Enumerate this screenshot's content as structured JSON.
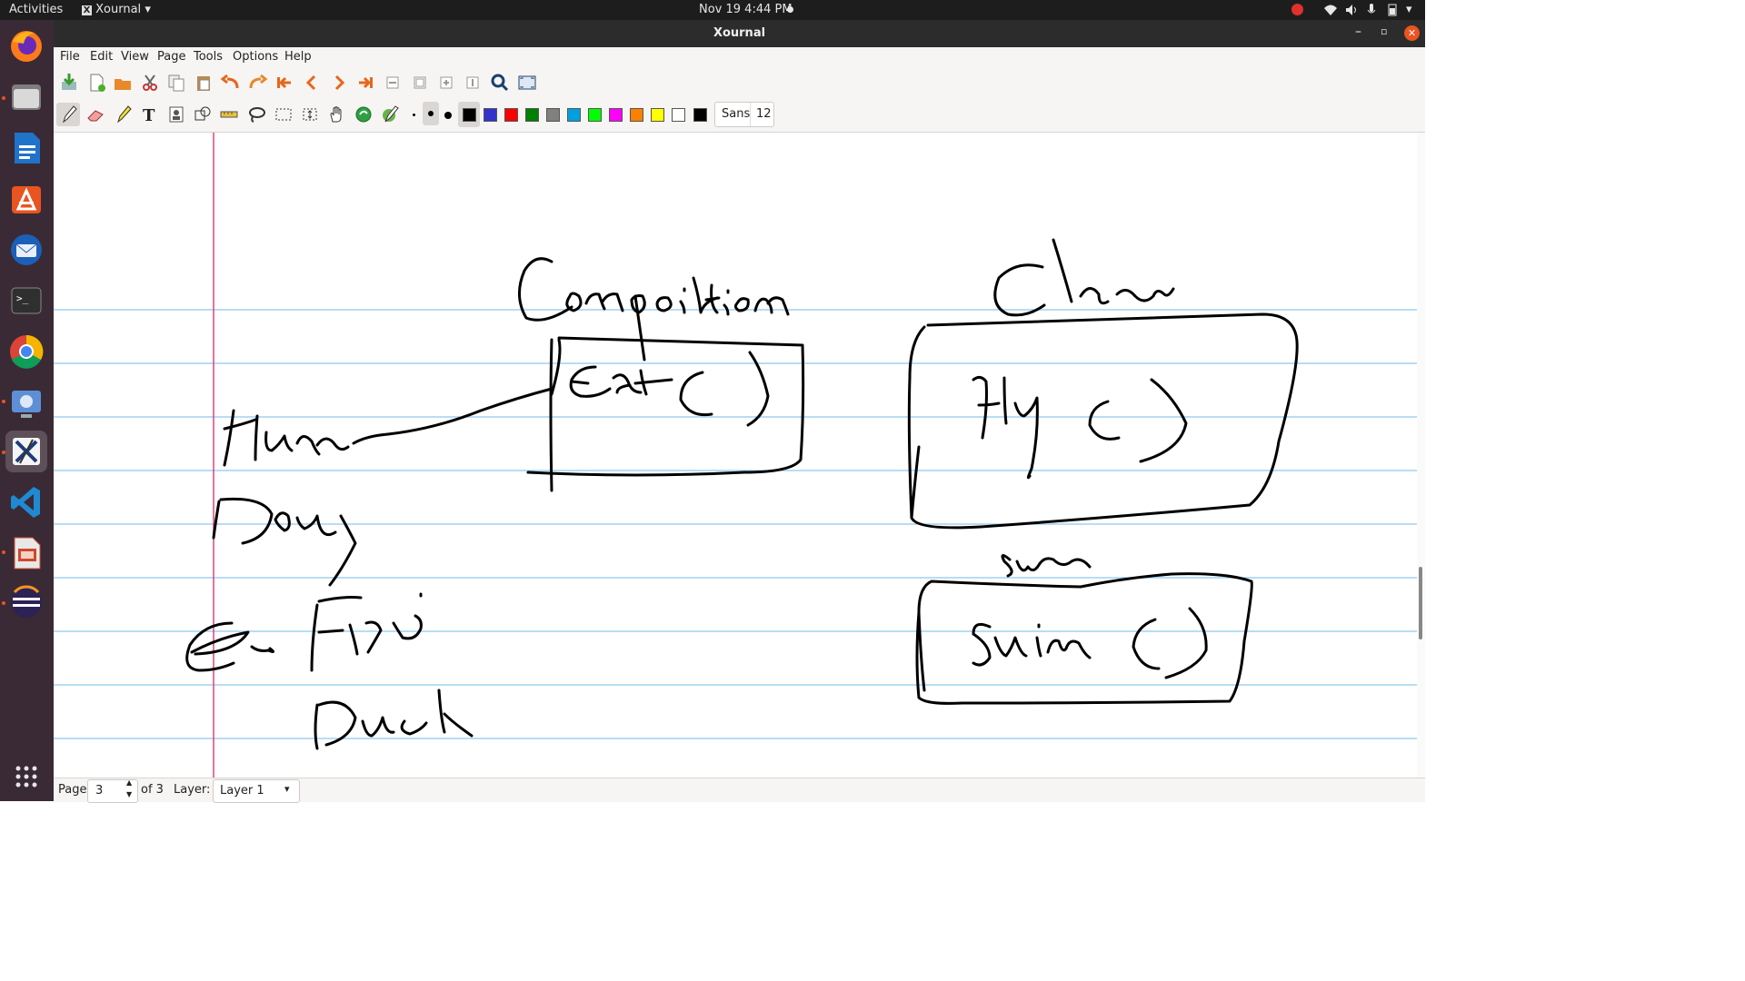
{
  "system_bar": {
    "activities": "Activities",
    "app_menu": "Xournal",
    "clock": "Nov 19  4:44 PM"
  },
  "window": {
    "title": "Xournal"
  },
  "menu": [
    "File",
    "Edit",
    "View",
    "Page",
    "Tools",
    "Options",
    "Help"
  ],
  "toolbar_font": {
    "name": "Sans",
    "size": "12"
  },
  "colors": {
    "accent": "#e95420",
    "rule_line": "#8fc8ee",
    "margin_line": "#e0457b",
    "swatches": [
      "#000000",
      "#3333cc",
      "#ff0000",
      "#008000",
      "#808080",
      "#00a0e0",
      "#00ff00",
      "#ff00ff",
      "#ff8000",
      "#ffff00",
      "#ffffff",
      "#000000"
    ]
  },
  "status": {
    "page_label": "Page",
    "page_value": "3",
    "page_total": "of 3",
    "layer_label": "Layer:",
    "layer_value": "Layer 1"
  }
}
